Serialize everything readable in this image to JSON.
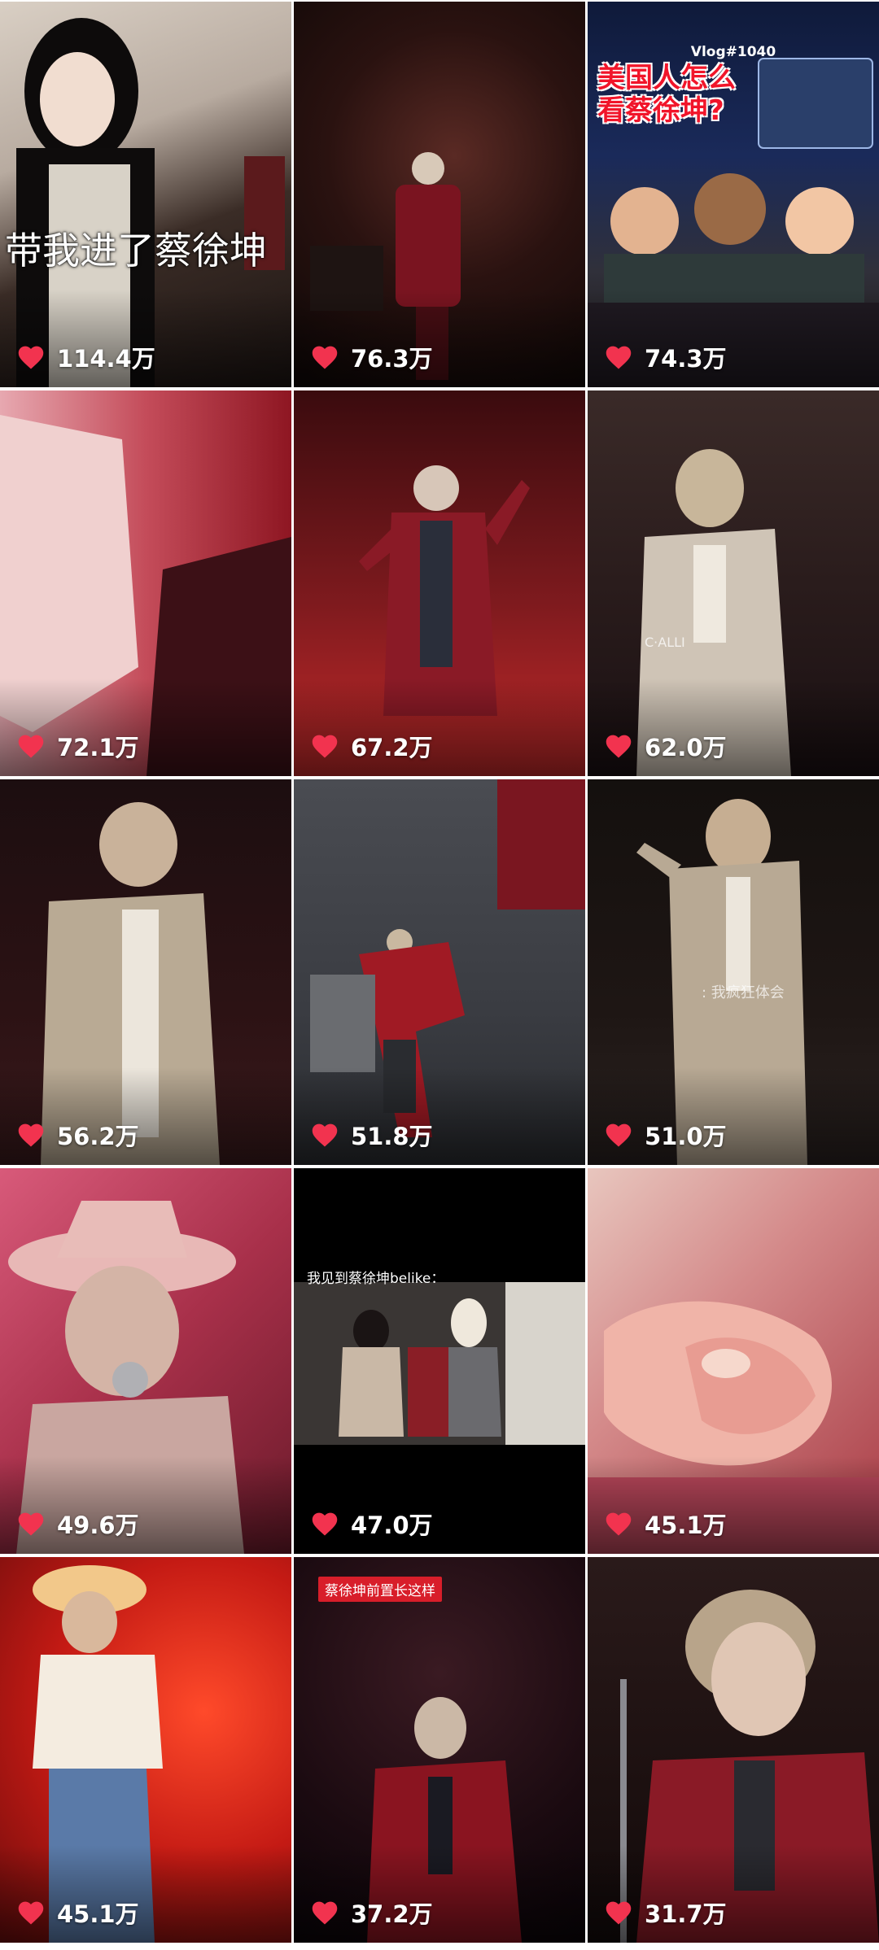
{
  "colors": {
    "heart": "#f2334f",
    "count_text": "#ffffff"
  },
  "icons": {
    "like": "heart-icon"
  },
  "videos": [
    {
      "likes": "114.4万",
      "caption": "带我进了蔡徐坤"
    },
    {
      "likes": "76.3万"
    },
    {
      "likes": "74.3万",
      "vlog_tag": "Vlog#1040",
      "vlog_title": "美国人怎么看蔡徐坤?"
    },
    {
      "likes": "72.1万"
    },
    {
      "likes": "67.2万"
    },
    {
      "likes": "62.0万"
    },
    {
      "likes": "56.2万"
    },
    {
      "likes": "51.8万"
    },
    {
      "likes": "51.0万",
      "subtitle": ": 我疯狂体会"
    },
    {
      "likes": "49.6万"
    },
    {
      "likes": "47.0万"
    },
    {
      "likes": "45.1万"
    },
    {
      "likes": "37.2万",
      "tag": "蔡徐坤前置长这样"
    },
    {
      "likes": "31.7万"
    },
    {
      "likes": ""
    }
  ]
}
